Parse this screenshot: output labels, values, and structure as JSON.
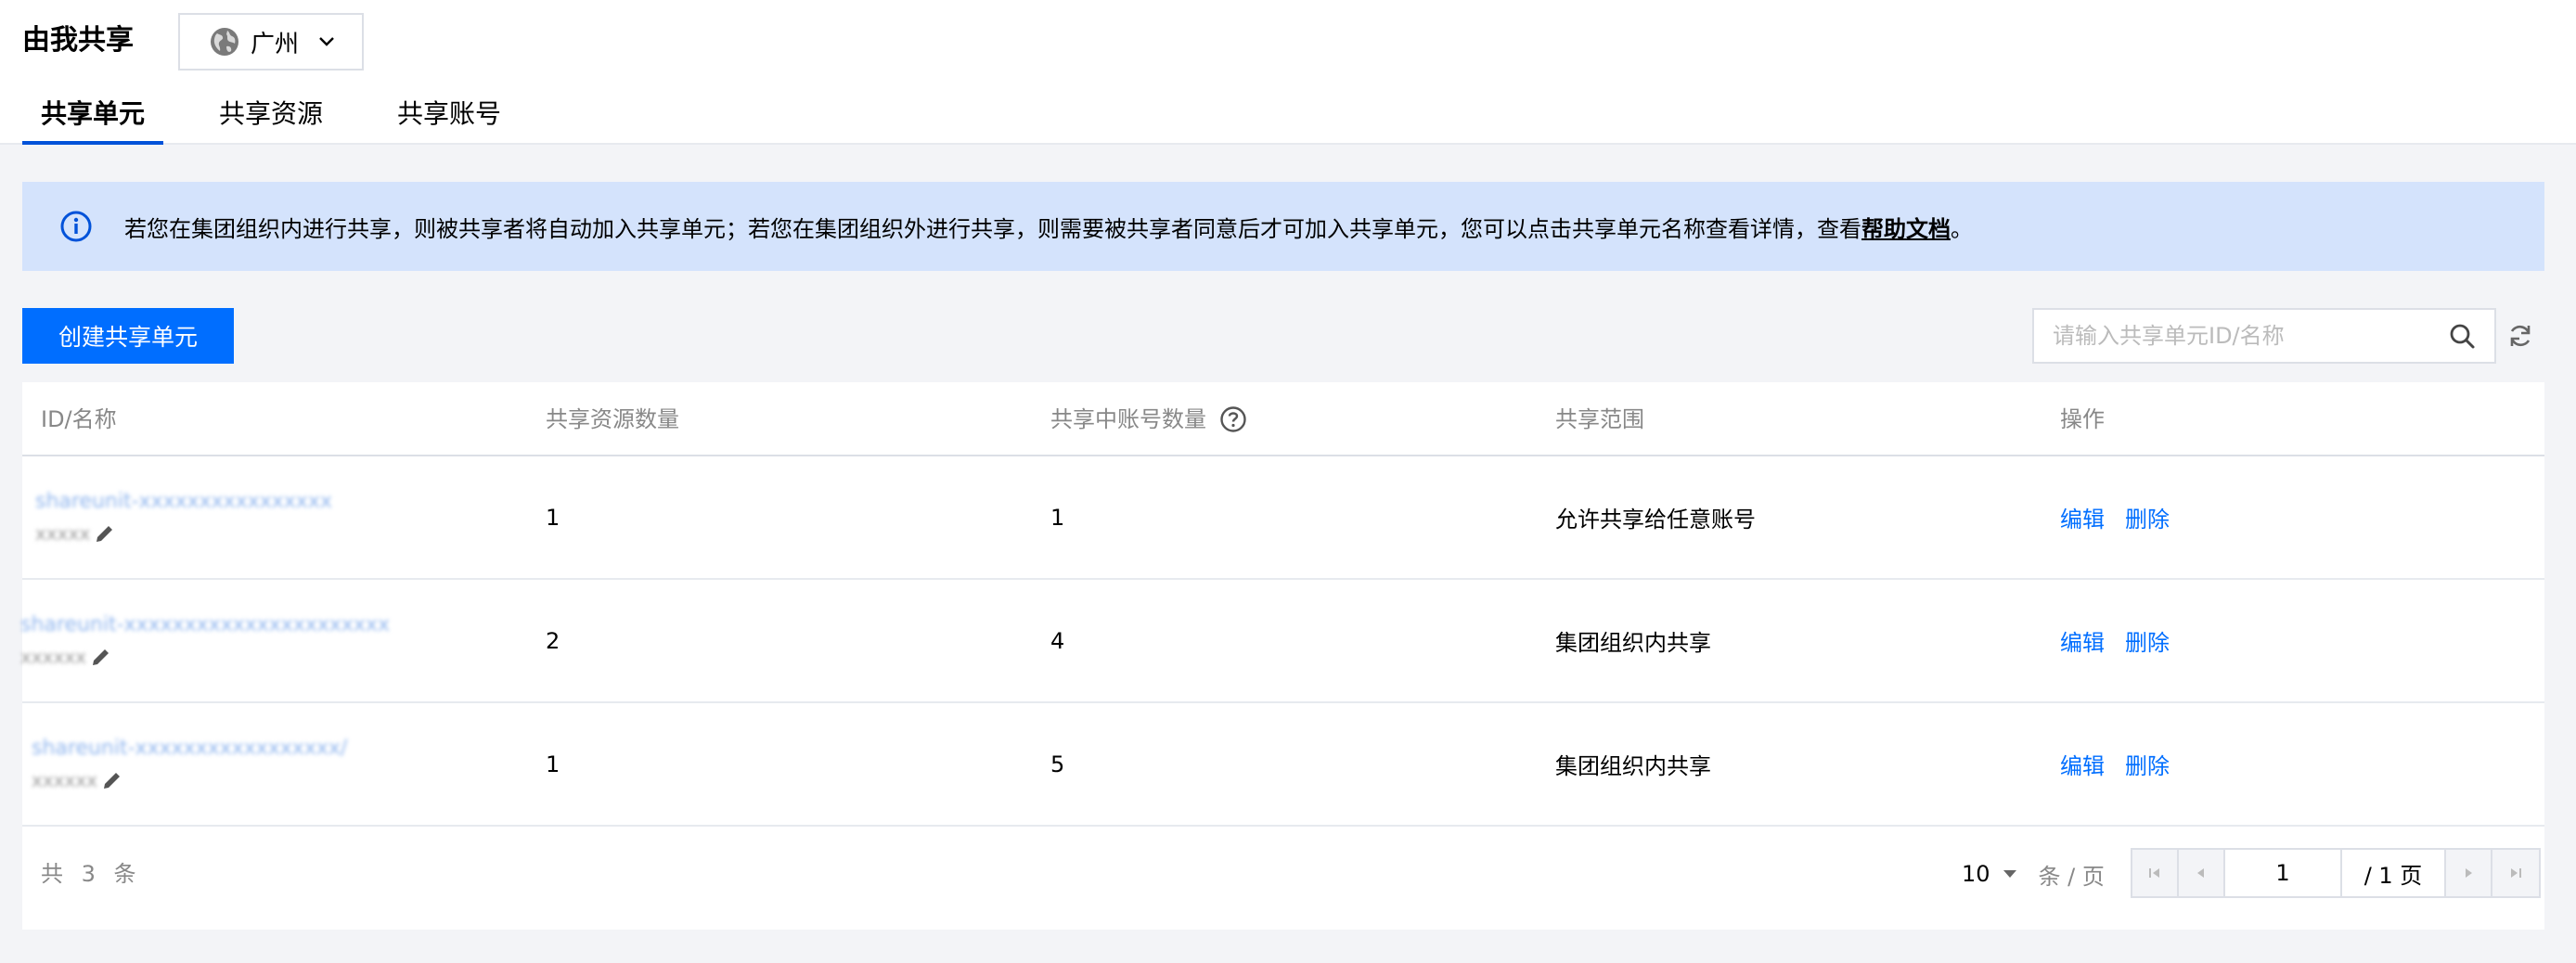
{
  "header": {
    "title": "由我共享",
    "region": "广州",
    "tabs": [
      {
        "label": "共享单元",
        "active": true
      },
      {
        "label": "共享资源",
        "active": false
      },
      {
        "label": "共享账号",
        "active": false
      }
    ]
  },
  "notice": {
    "text": "若您在集团组织内进行共享，则被共享者将自动加入共享单元；若您在集团组织外进行共享，则需要被共享者同意后才可加入共享单元，您可以点击共享单元名称查看详情，查看",
    "link": "帮助文档",
    "suffix": "。"
  },
  "toolbar": {
    "create_label": "创建共享单元",
    "search_placeholder": "请输入共享单元ID/名称"
  },
  "table": {
    "columns": [
      "ID/名称",
      "共享资源数量",
      "共享中账号数量",
      "共享范围",
      "操作"
    ],
    "rows": [
      {
        "id": "shareunit-xxxxxxxxxxxxxxxx",
        "name": "xxxxx",
        "resources": "1",
        "accounts": "1",
        "scope": "允许共享给任意账号",
        "edit": "编辑",
        "delete": "删除"
      },
      {
        "id": "shareunit-xxxxxxxxxxxxxxxxxxxxxx",
        "name": "xxxxxx",
        "resources": "2",
        "accounts": "4",
        "scope": "集团组织内共享",
        "edit": "编辑",
        "delete": "删除"
      },
      {
        "id": "shareunit-xxxxxxxxxxxxxxxxx/",
        "name": "xxxxxx",
        "resources": "1",
        "accounts": "5",
        "scope": "集团组织内共享",
        "edit": "编辑",
        "delete": "删除"
      }
    ]
  },
  "pagination": {
    "total": "共 3 条",
    "page_size": "10",
    "page_size_unit": "条 / 页",
    "current_page": "1",
    "total_pages": "/ 1 页"
  },
  "colors": {
    "primary": "#006eff",
    "notice_bg": "#d4e3fc",
    "tab_indicator": "#0052d9"
  }
}
